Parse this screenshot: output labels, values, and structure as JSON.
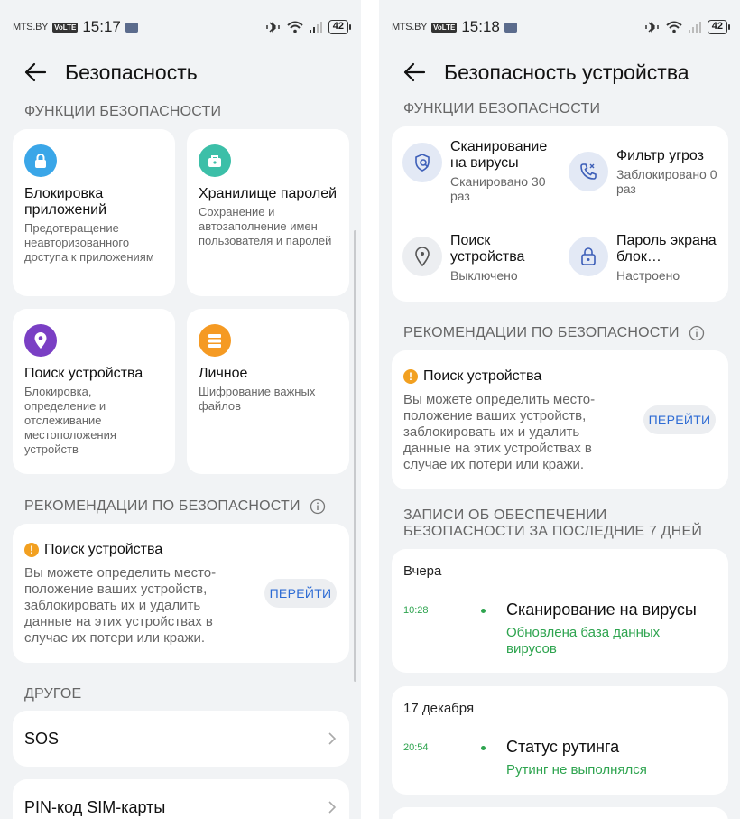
{
  "left_screen": {
    "status": {
      "carrier": "MTS.BY",
      "volte": "VoLTE",
      "time": "15:17",
      "battery": "42"
    },
    "title": "Безопасность",
    "section_functions": "ФУНКЦИИ БЕЗОПАСНОСТИ",
    "tiles": [
      {
        "title": "Блокировка приложений",
        "desc": "Предотвращение неавторизованного доступа к приложениям",
        "icon": "lock-icon",
        "color": "#3aa6e8"
      },
      {
        "title": "Хранилище паролей",
        "desc": "Сохранение и автозаполнение имен пользователя и паролей",
        "icon": "password-vault-icon",
        "color": "#3cbfa8"
      },
      {
        "title": "Поиск устройства",
        "desc": "Блокировка, определение и отслеживание местоположения устройств",
        "icon": "location-pin-icon",
        "color": "#7a3fc4"
      },
      {
        "title": "Личное",
        "desc": "Шифрование важных файлов",
        "icon": "private-storage-icon",
        "color": "#f59a23"
      }
    ],
    "section_recommendations": "РЕКОМЕНДАЦИИ ПО БЕЗОПАСНОСТИ",
    "recommendation": {
      "title": "Поиск устройства",
      "text": "Вы можете определить место­положение ваших устройств, заблокировать их и удалить данные на этих устройствах в случае их потери или кражи.",
      "button": "ПЕРЕЙТИ"
    },
    "section_other": "ДРУГОЕ",
    "other_items": [
      "SOS",
      "PIN-код SIM-карты"
    ]
  },
  "right_screen": {
    "status": {
      "carrier": "MTS.BY",
      "volte": "VoLTE",
      "time": "15:18",
      "battery": "42"
    },
    "title": "Безопасность устройства",
    "section_functions": "ФУНКЦИИ БЕЗОПАСНОСТИ",
    "features": [
      {
        "title": "Сканирование на вирусы",
        "subtitle": "Сканировано 30 раз",
        "icon": "virus-scan-icon"
      },
      {
        "title": "Фильтр угроз",
        "subtitle": "Заблокировано 0 раз",
        "icon": "phone-filter-icon"
      },
      {
        "title": "Поиск устройства",
        "subtitle": "Выключено",
        "icon": "location-pin-icon"
      },
      {
        "title": "Пароль экрана блок…",
        "subtitle": "Настроено",
        "icon": "lock-screen-icon"
      }
    ],
    "section_recommendations": "РЕКОМЕНДАЦИИ ПО БЕЗОПАСНОСТИ",
    "recommendation": {
      "title": "Поиск устройства",
      "text": "Вы можете определить место­положение ваших устройств, заблокировать их и удалить данные на этих устройствах в случае их потери или кражи.",
      "button": "ПЕРЕЙТИ"
    },
    "section_logs": "ЗАПИСИ ОБ ОБЕСПЕЧЕНИИ БЕЗОПАСНОСТИ ЗА ПОСЛЕДНИЕ 7 ДНЕЙ",
    "logs": [
      {
        "date": "Вчера",
        "time": "10:28",
        "title": "Сканирование на вирусы",
        "sub": "Обновлена база данных вирусов"
      },
      {
        "date": "17 декабря",
        "time": "20:54",
        "title": "Статус рутинга",
        "sub": "Рутинг не выполнялся"
      }
    ]
  },
  "colors": {
    "accent_blue": "#2d6bd4",
    "success_green": "#2ea44f",
    "warning_orange": "#f2a020",
    "background": "#f1f3f5"
  }
}
